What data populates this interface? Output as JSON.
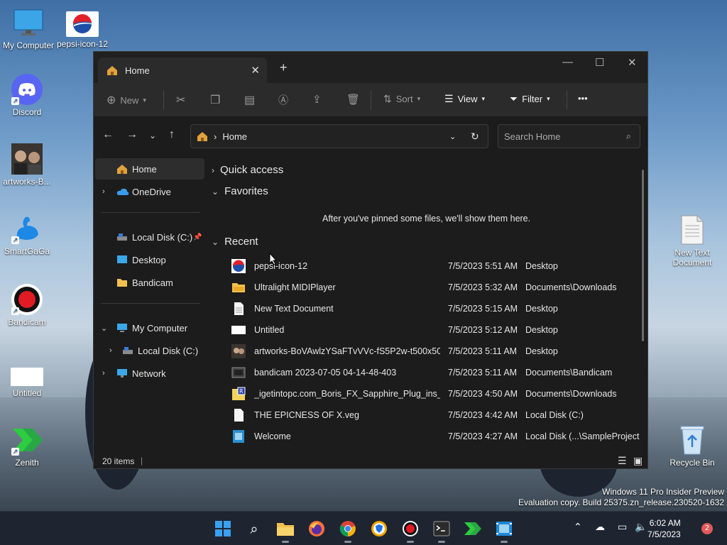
{
  "desktop": {
    "icons": [
      {
        "label": "My Computer"
      },
      {
        "label": "pepsi-icon-12"
      },
      {
        "label": "Discord"
      },
      {
        "label": "artworks-B..."
      },
      {
        "label": "SmartGaGa"
      },
      {
        "label": "Bandicam"
      },
      {
        "label": "Untitled"
      },
      {
        "label": "Zenith"
      },
      {
        "label": "New Text Document"
      },
      {
        "label": "Recycle Bin"
      }
    ]
  },
  "window": {
    "tab_title": "Home",
    "new_tab": "+",
    "controls": {
      "minimize": "—",
      "maximize": "☐",
      "close": "✕"
    },
    "toolbar": {
      "new_label": "New",
      "sort_label": "Sort",
      "view_label": "View",
      "filter_label": "Filter",
      "more_label": "•••"
    },
    "address": {
      "path": "Home",
      "separator": "›"
    },
    "search": {
      "placeholder": "Search Home"
    },
    "sidebar": {
      "home": "Home",
      "onedrive": "OneDrive",
      "local_disk": "Local Disk (C:)",
      "desktop": "Desktop",
      "bandicam": "Bandicam",
      "my_computer": "My Computer",
      "local_disk_2": "Local Disk (C:)",
      "network": "Network"
    },
    "content": {
      "quick_access": "Quick access",
      "favorites": "Favorites",
      "favorites_empty": "After you've pinned some files, we'll show them here.",
      "recent": "Recent",
      "files": [
        {
          "name": "pepsi-icon-12",
          "date": "7/5/2023 5:51 AM",
          "location": "Desktop",
          "icon": "pepsi-icon"
        },
        {
          "name": "Ultralight MIDIPlayer",
          "date": "7/5/2023 5:32 AM",
          "location": "Documents\\Downloads",
          "icon": "folder-icon"
        },
        {
          "name": "New Text Document",
          "date": "7/5/2023 5:15 AM",
          "location": "Desktop",
          "icon": "text-file-icon"
        },
        {
          "name": "Untitled",
          "date": "7/5/2023 5:12 AM",
          "location": "Desktop",
          "icon": "white-image-icon"
        },
        {
          "name": "artworks-BoVAwlzYSaFTvVVc-fS5P2w-t500x500",
          "date": "7/5/2023 5:11 AM",
          "location": "Desktop",
          "icon": "photo-icon"
        },
        {
          "name": "bandicam 2023-07-05 04-14-48-403",
          "date": "7/5/2023 5:11 AM",
          "location": "Documents\\Bandicam",
          "icon": "video-icon"
        },
        {
          "name": "_igetintopc.com_Boris_FX_Sapphire_Plug_ins_f...",
          "date": "7/5/2023 4:50 AM",
          "location": "Documents\\Downloads",
          "icon": "archive-icon"
        },
        {
          "name": "THE EPICNESS OF X.veg",
          "date": "7/5/2023 4:42 AM",
          "location": "Local Disk (C:)",
          "icon": "file-icon"
        },
        {
          "name": "Welcome",
          "date": "7/5/2023 4:27 AM",
          "location": "Local Disk (...\\SampleProject",
          "icon": "project-icon"
        }
      ]
    },
    "status": {
      "items": "20 items",
      "divider": "|"
    }
  },
  "watermark": {
    "line1": "Windows 11 Pro Insider Preview",
    "line2": "Evaluation copy. Build 25375.zn_release.230520-1632"
  },
  "taskbar": {
    "clock_time": "6:02 AM",
    "clock_date": "7/5/2023",
    "notification_count": "2"
  },
  "colors": {
    "accent": "#0078d4",
    "window_bg": "#1c1c1c",
    "taskbar_bg": "#1f2530"
  }
}
